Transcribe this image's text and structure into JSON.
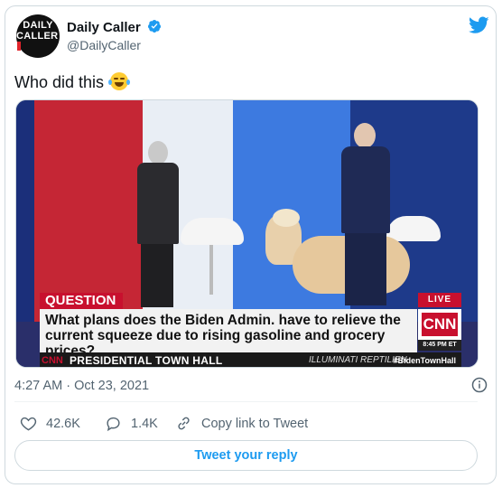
{
  "tweet": {
    "author": {
      "name": "Daily Caller",
      "handle": "@DailyCaller",
      "avatar_line1": "DAILY",
      "avatar_line2": "CALLER"
    },
    "text": "Who did this",
    "emoji": "face-with-tears-of-joy-icon",
    "timestamp": "4:27 AM · Oct 23, 2021"
  },
  "media": {
    "question_tag": "QUESTION",
    "question_line1": "What plans does the Biden Admin. have to relieve the",
    "question_line2": "current squeeze due to rising gasoline and grocery prices?",
    "live_label": "LIVE",
    "network_logo": "CNN",
    "bug_time": "8:45 PM ET",
    "bar_logo": "CNN",
    "bar_title": "PRESIDENTIAL TOWN HALL",
    "bar_watermark": "ILLUMINATI REPTILIEN",
    "hashtag": "#BidenTownHall"
  },
  "actions": {
    "likes": "42.6K",
    "replies": "1.4K",
    "copy_link": "Copy link to Tweet"
  },
  "reply_button": "Tweet your reply",
  "colors": {
    "accent": "#1d9bf0",
    "text": "#0f1419",
    "muted": "#536471",
    "cnn_red": "#c8102e"
  }
}
